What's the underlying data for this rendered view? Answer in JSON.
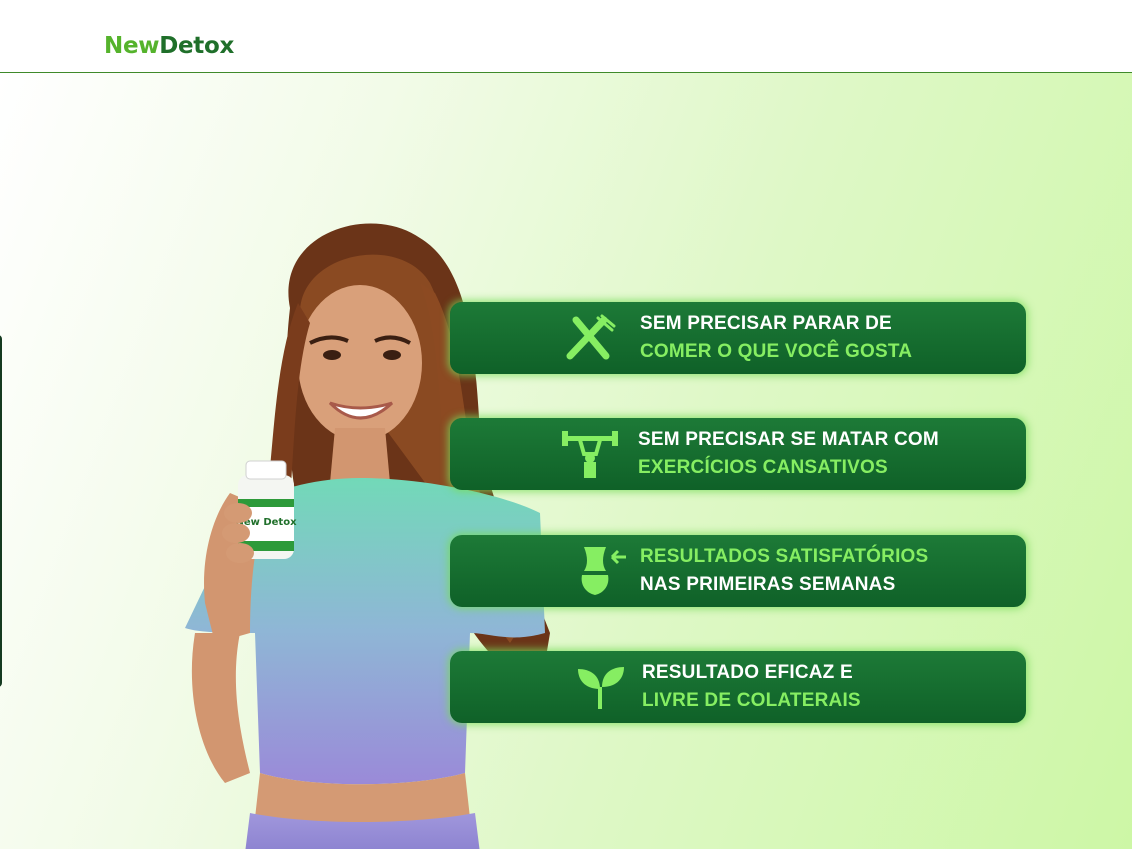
{
  "brand": {
    "part1": "New",
    "part2": "Detox"
  },
  "benefits": [
    {
      "line1": "SEM PRECISAR PARAR DE",
      "line2": "COMER O QUE VOCÊ GOSTA",
      "icon": "fork-knife-icon"
    },
    {
      "line1": "SEM PRECISAR SE MATAR COM",
      "line2": "EXERCÍCIOS CANSATIVOS",
      "icon": "weightlifting-icon"
    },
    {
      "line1": "RESULTADOS SATISFATÓRIOS",
      "line2": "NAS PRIMEIRAS SEMANAS",
      "icon": "waist-slimming-icon"
    },
    {
      "line1": "RESULTADO EFICAZ E",
      "line2": "LIVRE DE COLATERAIS",
      "icon": "leaf-sprout-icon"
    }
  ],
  "product": {
    "label": "New Detox"
  },
  "colors": {
    "brand_light": "#55b32c",
    "brand_dark": "#1f6f2a",
    "banner": "#17702f",
    "highlight_text": "#86ee62"
  }
}
